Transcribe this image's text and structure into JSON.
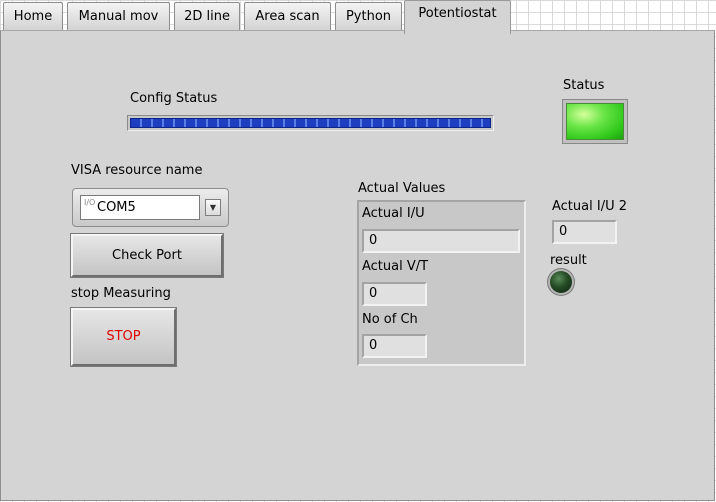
{
  "tabs": [
    {
      "label": "Home"
    },
    {
      "label": "Manual mov"
    },
    {
      "label": "2D line"
    },
    {
      "label": "Area scan"
    },
    {
      "label": "Python"
    },
    {
      "label": "Potentiostat"
    }
  ],
  "active_tab": "Potentiostat",
  "config_status": {
    "label": "Config Status",
    "progress": 1.0
  },
  "status": {
    "label": "Status",
    "state": "on",
    "color": "#39d11f"
  },
  "visa": {
    "label": "VISA resource name",
    "value": "COM5",
    "io_icon": "I/O"
  },
  "check_port": {
    "label": "Check Port"
  },
  "stop": {
    "label": "stop Measuring",
    "button_text": "STOP",
    "color": "#e00000"
  },
  "actual_values": {
    "label": "Actual Values",
    "iu": {
      "label": "Actual I/U",
      "value": "0"
    },
    "vt": {
      "label": "Actual V/T",
      "value": "0"
    },
    "ch": {
      "label": "No of Ch",
      "value": "0"
    }
  },
  "actual_iu2": {
    "label": "Actual I/U 2",
    "value": "0"
  },
  "result": {
    "label": "result",
    "state": "off"
  }
}
